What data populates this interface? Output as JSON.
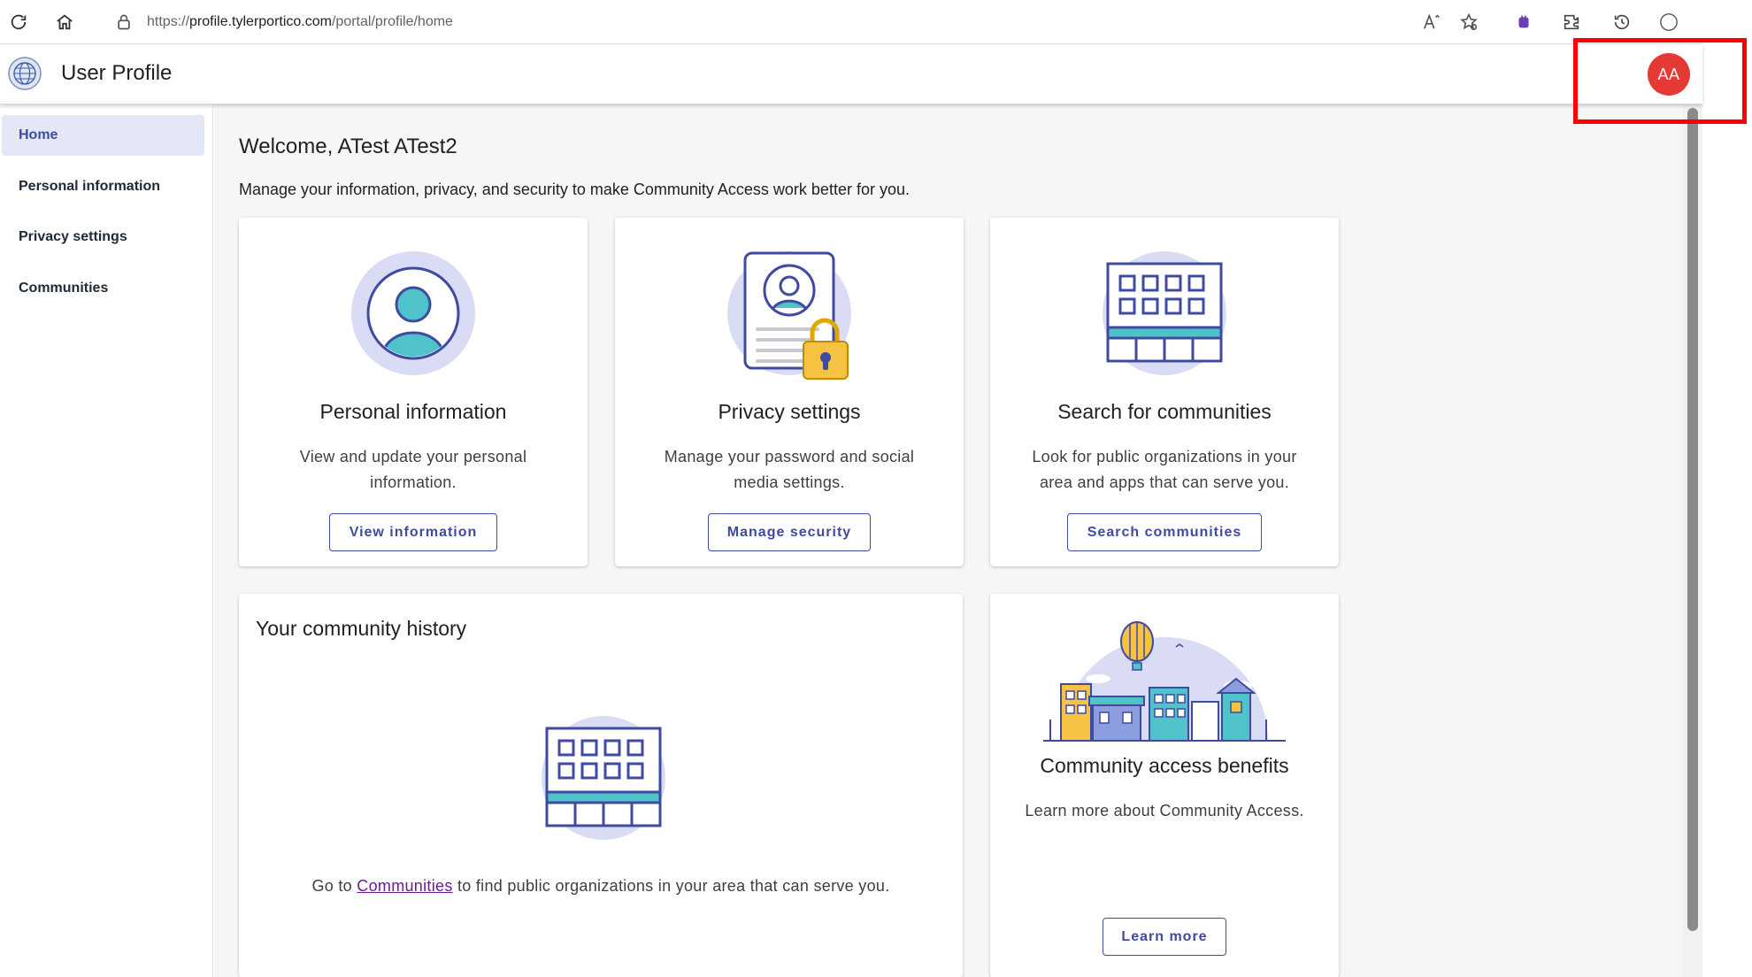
{
  "browser": {
    "url_prefix": "https://",
    "url_host": "profile.tylerportico.com",
    "url_path": "/portal/profile/home"
  },
  "header": {
    "title": "User Profile",
    "avatar_initials": "AA",
    "avatar_color": "#e53935"
  },
  "sidebar": {
    "items": [
      {
        "label": "Home",
        "active": true
      },
      {
        "label": "Personal information",
        "active": false
      },
      {
        "label": "Privacy settings",
        "active": false
      },
      {
        "label": "Communities",
        "active": false
      }
    ]
  },
  "main": {
    "welcome": "Welcome, ATest ATest2",
    "subtitle": "Manage your information, privacy, and security to make Community Access work better for you.",
    "cards": [
      {
        "title": "Personal information",
        "desc": "View and update your personal information.",
        "button": "View information",
        "icon": "person-icon"
      },
      {
        "title": "Privacy settings",
        "desc": "Manage your password and social media settings.",
        "button": "Manage security",
        "icon": "lock-document-icon"
      },
      {
        "title": "Search for communities",
        "desc": "Look for public organizations in your area and apps that can serve you.",
        "button": "Search communities",
        "icon": "building-icon"
      }
    ],
    "history": {
      "title": "Your community history",
      "text_before": "Go to ",
      "link": "Communities",
      "text_after": " to find public organizations in your area that can serve you."
    },
    "benefits": {
      "title": "Community access benefits",
      "desc": "Learn more about Community Access.",
      "button": "Learn more"
    }
  },
  "colors": {
    "accent": "#3f4aa1",
    "active_nav_bg": "#e4e7f5",
    "illustration_circle": "#d9dcf4",
    "illustration_teal": "#4fc3c9",
    "illustration_yellow": "#f5c242",
    "highlight": "#ff0000"
  }
}
